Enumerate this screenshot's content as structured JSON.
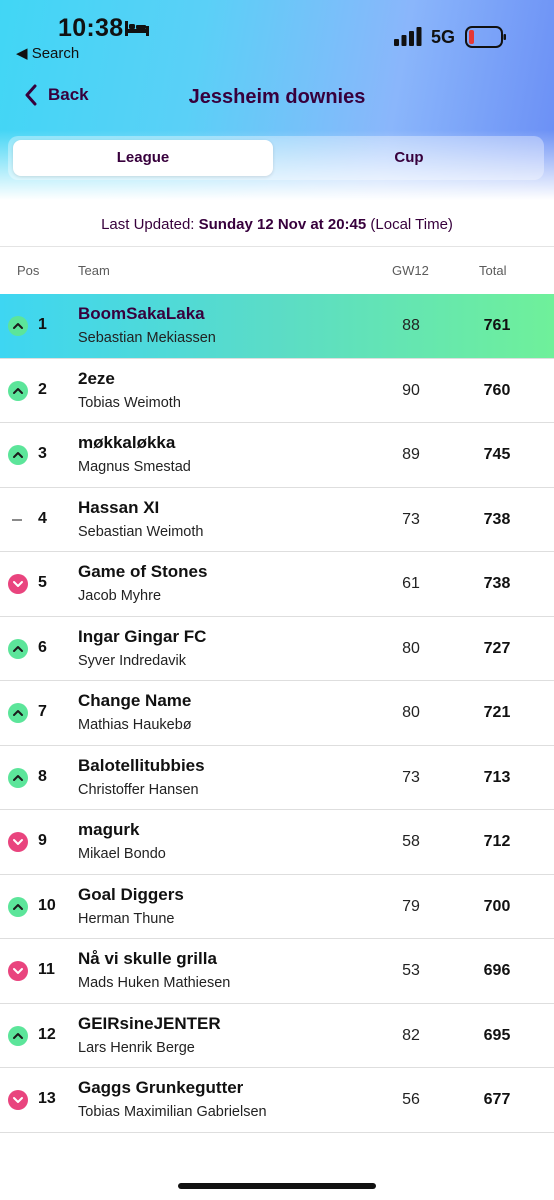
{
  "status_bar": {
    "time": "10:38",
    "back_app": "◀ Search",
    "network": "5G"
  },
  "nav": {
    "back_label": "Back",
    "title": "Jessheim downies"
  },
  "tabs": [
    {
      "label": "League",
      "selected": true
    },
    {
      "label": "Cup",
      "selected": false
    }
  ],
  "last_updated": {
    "prefix": "Last Updated:",
    "datetime": "Sunday 12 Nov at 20:45",
    "suffix": "(Local Time)"
  },
  "columns": {
    "pos": "Pos",
    "team": "Team",
    "gw": "GW12",
    "total": "Total"
  },
  "standings": [
    {
      "movement": "up",
      "pos": "1",
      "team": "BoomSakaLaka",
      "manager": "Sebastian Mekiassen",
      "gw": "88",
      "total": "761"
    },
    {
      "movement": "up",
      "pos": "2",
      "team": "2eze",
      "manager": "Tobias Weimoth",
      "gw": "90",
      "total": "760"
    },
    {
      "movement": "up",
      "pos": "3",
      "team": "møkkaløkka",
      "manager": "Magnus Smestad",
      "gw": "89",
      "total": "745"
    },
    {
      "movement": "same",
      "pos": "4",
      "team": "Hassan XI",
      "manager": "Sebastian Weimoth",
      "gw": "73",
      "total": "738"
    },
    {
      "movement": "down",
      "pos": "5",
      "team": "Game of Stones",
      "manager": "Jacob Myhre",
      "gw": "61",
      "total": "738"
    },
    {
      "movement": "up",
      "pos": "6",
      "team": "Ingar Gingar FC",
      "manager": "Syver Indredavik",
      "gw": "80",
      "total": "727"
    },
    {
      "movement": "up",
      "pos": "7",
      "team": "Change Name",
      "manager": "Mathias Haukebø",
      "gw": "80",
      "total": "721"
    },
    {
      "movement": "up",
      "pos": "8",
      "team": "Balotellitubbies",
      "manager": "Christoffer Hansen",
      "gw": "73",
      "total": "713"
    },
    {
      "movement": "down",
      "pos": "9",
      "team": "magurk",
      "manager": "Mikael Bondo",
      "gw": "58",
      "total": "712"
    },
    {
      "movement": "up",
      "pos": "10",
      "team": "Goal Diggers",
      "manager": "Herman Thune",
      "gw": "79",
      "total": "700"
    },
    {
      "movement": "down",
      "pos": "11",
      "team": "Nå vi skulle grilla",
      "manager": "Mads Huken Mathiesen",
      "gw": "53",
      "total": "696"
    },
    {
      "movement": "up",
      "pos": "12",
      "team": "GEIRsineJENTER",
      "manager": "Lars Henrik Berge",
      "gw": "82",
      "total": "695"
    },
    {
      "movement": "down",
      "pos": "13",
      "team": "Gaggs Grunkegutter",
      "manager": "Tobias Maximilian Gabrielsen",
      "gw": "56",
      "total": "677"
    }
  ]
}
